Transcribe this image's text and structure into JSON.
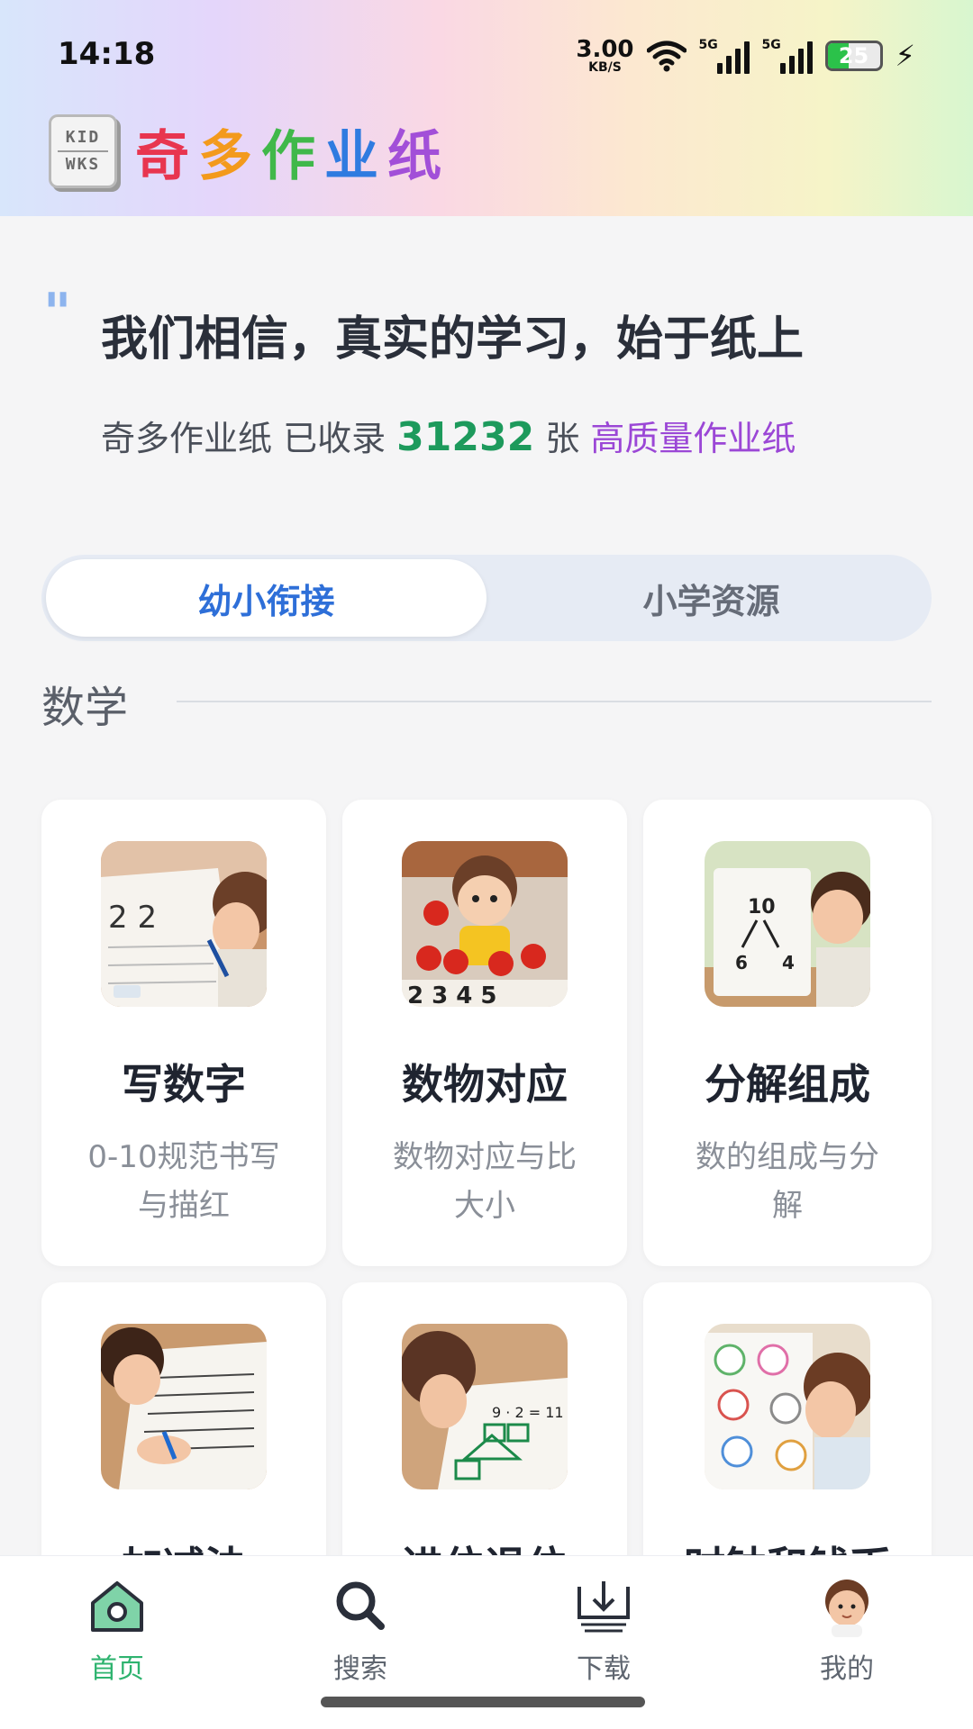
{
  "status_bar": {
    "time": "14:18",
    "net_speed_value": "3.00",
    "net_speed_unit": "KB/S",
    "network_1": "5G",
    "network_2": "5G",
    "battery_level": "25",
    "icons": [
      "wifi-icon",
      "signal-icon",
      "signal-icon",
      "battery-icon",
      "charging-icon"
    ]
  },
  "brand": {
    "logo_line1": "KID",
    "logo_line2": "WKS",
    "title_chars": [
      "奇",
      "多",
      "作",
      "业",
      "纸"
    ]
  },
  "hero": {
    "quote_mark": "\"",
    "title": "我们相信，真实的学习，始于纸上",
    "subtitle_prefix": "奇多作业纸 已收录 ",
    "count": "31232",
    "subtitle_mid": " 张 ",
    "subtitle_highlight": "高质量作业纸"
  },
  "tabs": [
    {
      "label": "幼小衔接",
      "active": true
    },
    {
      "label": "小学资源",
      "active": false
    }
  ],
  "section": {
    "title": "数学"
  },
  "cards": [
    {
      "title": "写数字",
      "desc": "0-10规范书写与描红",
      "image": "child-writing-numbers"
    },
    {
      "title": "数物对应",
      "desc": "数物对应与比大小",
      "image": "child-counting-apples"
    },
    {
      "title": "分解组成",
      "desc": "数的组成与分解",
      "image": "child-number-bond-board"
    },
    {
      "title": "加减法",
      "desc": "",
      "image": "child-addition-worksheet"
    },
    {
      "title": "进位退位",
      "desc": "",
      "image": "child-carry-worksheet"
    },
    {
      "title": "时钟和钱币",
      "desc": "",
      "image": "child-clock-worksheet"
    }
  ],
  "bottom_nav": [
    {
      "label": "首页",
      "icon": "home-icon",
      "active": true
    },
    {
      "label": "搜索",
      "icon": "search-icon",
      "active": false
    },
    {
      "label": "下载",
      "icon": "download-icon",
      "active": false
    },
    {
      "label": "我的",
      "icon": "avatar-icon",
      "active": false
    }
  ],
  "colors": {
    "accent_green": "#2eb36f",
    "accent_blue": "#2e6fd8",
    "highlight_purple": "#9b47d6",
    "count_green": "#1d9a5c"
  }
}
